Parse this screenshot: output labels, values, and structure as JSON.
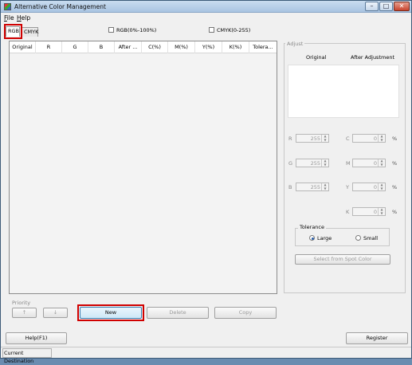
{
  "window": {
    "title": "Alternative Color Management",
    "controls": {
      "minimize": "–",
      "maximize": "□",
      "close": "✕"
    }
  },
  "menu": {
    "file": "File",
    "help": "Help"
  },
  "tabs": {
    "rgb": "RGB",
    "cmyk": "CMYK"
  },
  "options": {
    "rgb_percent_label": "RGB(0%-100%)",
    "cmyk_range_label": "CMYK(0-255)"
  },
  "list": {
    "columns": [
      "Original",
      "R",
      "G",
      "B",
      "After ...",
      "C(%)",
      "M(%)",
      "Y(%)",
      "K(%)",
      "Tolera..."
    ]
  },
  "priority": {
    "label": "Priority",
    "up": "↑",
    "down": "↓"
  },
  "actions": {
    "new": "New",
    "delete": "Delete",
    "copy": "Copy"
  },
  "adjust": {
    "title": "Adjust",
    "original": "Original",
    "after": "After Adjustment",
    "fields": [
      {
        "label": "R",
        "value": "255"
      },
      {
        "label": "G",
        "value": "255"
      },
      {
        "label": "B",
        "value": "255"
      },
      {
        "label": "C",
        "value": "0",
        "unit": "%"
      },
      {
        "label": "M",
        "value": "0",
        "unit": "%"
      },
      {
        "label": "Y",
        "value": "0",
        "unit": "%"
      },
      {
        "label": "K",
        "value": "0",
        "unit": "%"
      }
    ],
    "tolerance": {
      "title": "Tolerance",
      "large": "Large",
      "small": "Small",
      "selected": "Large"
    },
    "spot_button": "Select from Spot Color"
  },
  "footer": {
    "help": "Help(F1)",
    "register": "Register"
  },
  "status": {
    "destination": "Current Destination"
  },
  "colors": {
    "highlight": "#d00000",
    "title_bar": "#b9d1ea"
  }
}
